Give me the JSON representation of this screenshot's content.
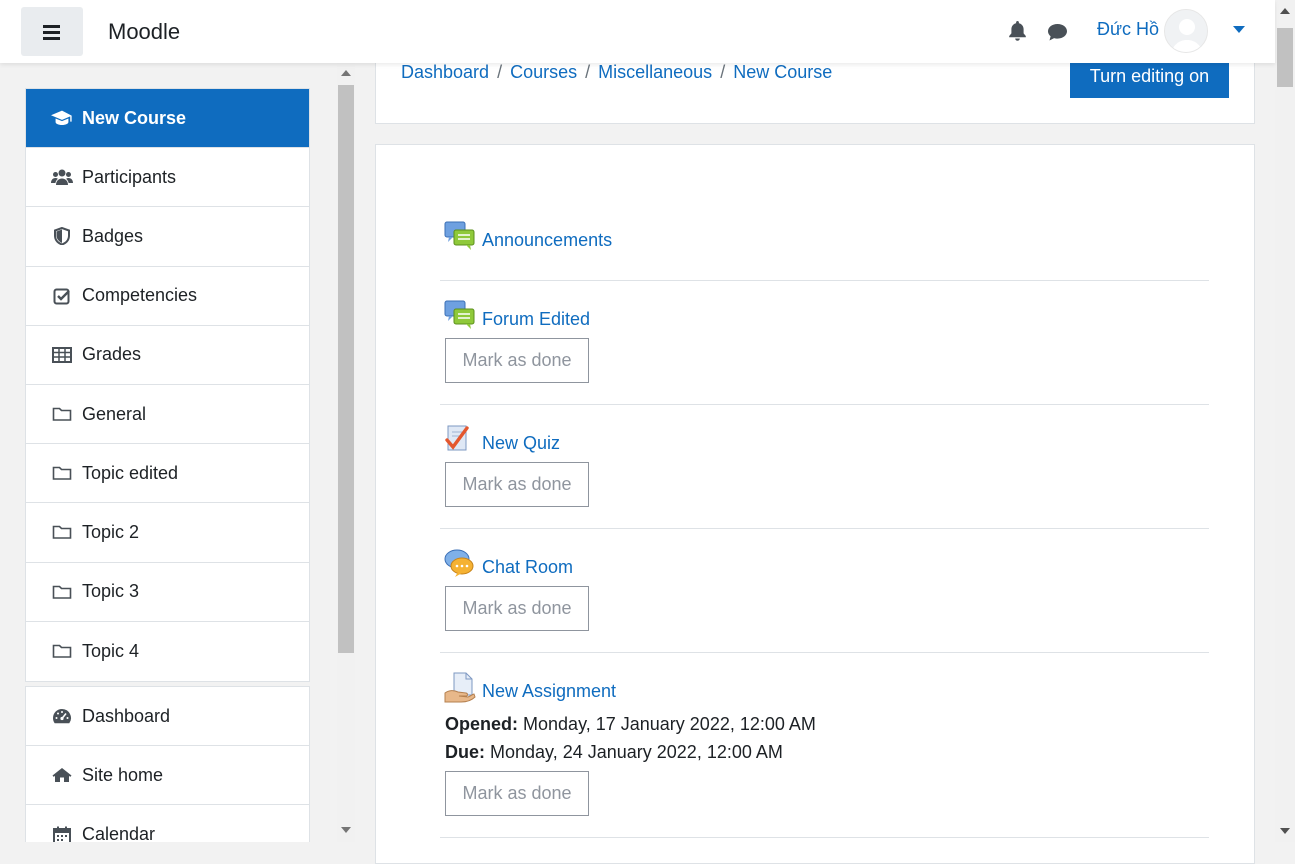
{
  "navbar": {
    "brand": "Moodle",
    "user_name": "Đức Hồ"
  },
  "drawer": {
    "course_items": [
      {
        "label": "New Course",
        "icon": "graduation-cap-icon",
        "active": true
      },
      {
        "label": "Participants",
        "icon": "users-icon"
      },
      {
        "label": "Badges",
        "icon": "shield-icon"
      },
      {
        "label": "Competencies",
        "icon": "checkbox-icon"
      },
      {
        "label": "Grades",
        "icon": "table-icon"
      },
      {
        "label": "General",
        "icon": "folder-icon"
      },
      {
        "label": "Topic edited",
        "icon": "folder-icon"
      },
      {
        "label": "Topic 2",
        "icon": "folder-icon"
      },
      {
        "label": "Topic 3",
        "icon": "folder-icon"
      },
      {
        "label": "Topic 4",
        "icon": "folder-icon"
      }
    ],
    "site_items": [
      {
        "label": "Dashboard",
        "icon": "tachometer-icon"
      },
      {
        "label": "Site home",
        "icon": "home-icon"
      },
      {
        "label": "Calendar",
        "icon": "calendar-icon"
      }
    ]
  },
  "breadcrumb": [
    "Dashboard",
    "Courses",
    "Miscellaneous",
    "New Course"
  ],
  "edit_button": "Turn editing on",
  "activities": [
    {
      "title": "Announcements",
      "icon": "forum-icon",
      "mark": null
    },
    {
      "title": "Forum Edited",
      "icon": "forum-icon",
      "mark": "Mark as done"
    },
    {
      "title": "New Quiz",
      "icon": "quiz-icon",
      "mark": "Mark as done"
    },
    {
      "title": "Chat Room",
      "icon": "chat-icon",
      "mark": "Mark as done"
    },
    {
      "title": "New Assignment",
      "icon": "assignment-icon",
      "mark": "Mark as done",
      "opened_label": "Opened:",
      "opened_value": "Monday, 17 January 2022, 12:00 AM",
      "due_label": "Due:",
      "due_value": "Monday, 24 January 2022, 12:00 AM"
    }
  ],
  "colors": {
    "accent": "#0f6cbf",
    "border": "#dee2e6"
  }
}
